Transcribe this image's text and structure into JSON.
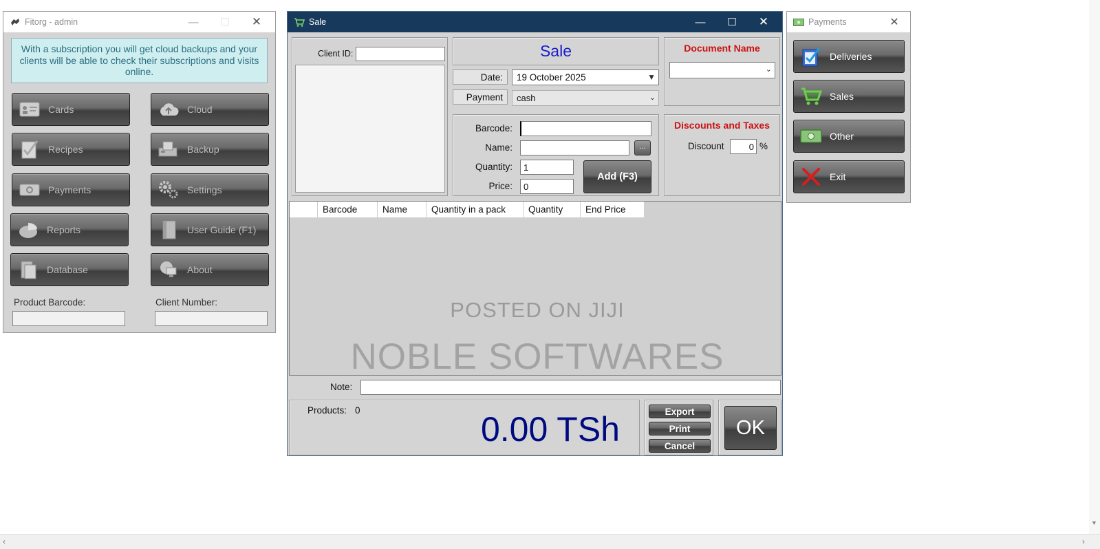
{
  "main_window": {
    "title": "Fitorg - admin",
    "subscription_notice": "With a subscription you will get cloud backups and your clients will be able to check their subscriptions and visits online.",
    "buttons": {
      "cards": "Cards",
      "cloud": "Cloud",
      "recipes": "Recipes",
      "backup": "Backup",
      "payments": "Payments",
      "settings": "Settings",
      "reports": "Reports",
      "user_guide": "User Guide (F1)",
      "database": "Database",
      "about": "About"
    },
    "product_barcode_label": "Product Barcode:",
    "product_barcode_value": "",
    "client_number_label": "Client Number:",
    "client_number_value": ""
  },
  "sale_window": {
    "title": "Sale",
    "client_id_label": "Client ID:",
    "client_id_value": "",
    "heading": "Sale",
    "date_label": "Date:",
    "date_value": "19 October 2025",
    "payment_label": "Payment",
    "payment_value": "cash",
    "document_name_label": "Document Name",
    "document_name_value": "",
    "barcode_label": "Barcode:",
    "barcode_value": "",
    "name_label": "Name:",
    "name_value": "",
    "browse_label": "...",
    "quantity_label": "Quantity:",
    "quantity_value": "1",
    "price_label": "Price:",
    "price_value": "0",
    "add_button": "Add (F3)",
    "discounts_heading": "Discounts and Taxes",
    "discount_label": "Discount",
    "discount_value": "0",
    "percent_sign": "%",
    "table_columns": [
      "",
      "Barcode",
      "Name",
      "Quantity in a pack",
      "Quantity",
      "End Price"
    ],
    "watermark_small": "POSTED ON JIJI",
    "watermark_large": "NOBLE SOFTWARES",
    "note_label": "Note:",
    "note_value": "",
    "products_label": "Products:",
    "products_count": "0",
    "total": "0.00 TSh",
    "export_button": "Export",
    "print_button": "Print",
    "cancel_button": "Cancel",
    "ok_button": "OK"
  },
  "payments_window": {
    "title": "Payments",
    "buttons": {
      "deliveries": "Deliveries",
      "sales": "Sales",
      "other": "Other",
      "exit": "Exit"
    }
  },
  "colors": {
    "sale_titlebar": "#173a5c",
    "notice_bg": "#cfeef0",
    "notice_text": "#2a6e80",
    "heading_blue": "#1a1acc",
    "total_blue": "#000a80",
    "heading_red": "#cc1111"
  }
}
